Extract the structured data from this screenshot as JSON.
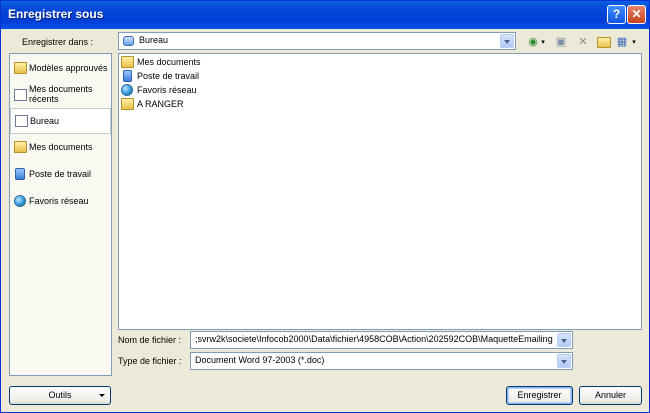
{
  "window": {
    "title": "Enregistrer sous",
    "help_label": "?",
    "close_label": "✕"
  },
  "header": {
    "save_in_label": "Enregistrer dans :",
    "save_in_value": "Bureau",
    "tool_icons": [
      "back-icon",
      "up-folder-icon",
      "delete-icon",
      "new-folder-icon",
      "views-icon"
    ]
  },
  "places": [
    {
      "label": "Modèles approuvés",
      "icon": "folder-icon"
    },
    {
      "label": "Mes documents récents",
      "line1": "Mes documents",
      "line2": "récents",
      "icon": "recent-docs-icon"
    },
    {
      "label": "Bureau",
      "icon": "desktop-icon",
      "selected": true
    },
    {
      "label": "Mes documents",
      "icon": "my-documents-icon"
    },
    {
      "label": "Poste de travail",
      "icon": "computer-icon"
    },
    {
      "label": "Favoris réseau",
      "icon": "network-icon"
    }
  ],
  "files": [
    {
      "name": "Mes documents",
      "icon": "my-documents-icon"
    },
    {
      "name": "Poste de travail",
      "icon": "computer-icon"
    },
    {
      "name": "Favoris réseau",
      "icon": "network-icon"
    },
    {
      "name": "A RANGER",
      "icon": "folder-icon"
    }
  ],
  "filename": {
    "label": "Nom de fichier :",
    "value": ";svrw2k\\societe\\Infocob2000\\Data\\fichier\\4958COB\\Action\\202592COB\\MaquetteEmailing"
  },
  "filetype": {
    "label": "Type de fichier :",
    "value": "Document Word 97-2003 (*.doc)"
  },
  "buttons": {
    "tools": "Outils",
    "save": "Enregistrer",
    "cancel": "Annuler"
  }
}
